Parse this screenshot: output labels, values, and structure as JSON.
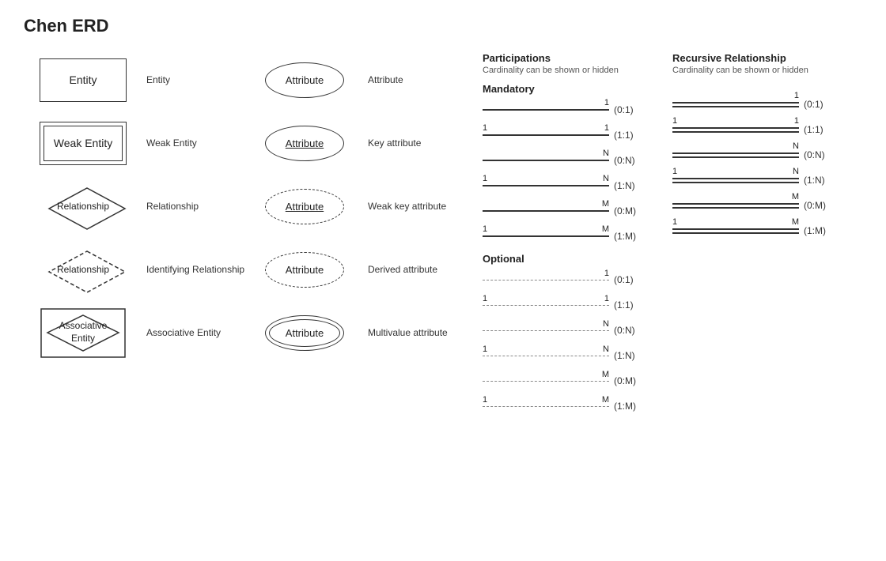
{
  "title": "Chen ERD",
  "symbols": [
    {
      "type": "entity",
      "shape": "entity-rect",
      "text": "Entity",
      "label": "Entity"
    },
    {
      "type": "weak-entity",
      "shape": "weak-entity-rect",
      "text": "Weak Entity",
      "label": "Weak Entity"
    },
    {
      "type": "relationship",
      "shape": "diamond",
      "text": "Relationship",
      "label": "Relationship"
    },
    {
      "type": "identifying-relationship",
      "shape": "diamond-dashed",
      "text": "Relationship",
      "label": "Identifying Relationship"
    },
    {
      "type": "associative-entity",
      "shape": "assoc-entity",
      "text": "Associative\nEntity",
      "label": "Associative Entity"
    }
  ],
  "attributes": [
    {
      "type": "normal",
      "text": "Attribute",
      "label": "Attribute"
    },
    {
      "type": "key",
      "text": "Attribute",
      "label": "Key attribute"
    },
    {
      "type": "weak-key",
      "text": "Attribute",
      "label": "Weak key attribute"
    },
    {
      "type": "derived",
      "text": "Attribute",
      "label": "Derived attribute"
    },
    {
      "type": "multivalue",
      "text": "Attribute",
      "label": "Multivalue attribute"
    }
  ],
  "participations": {
    "title": "Participations",
    "subtitle": "Cardinality can be shown or hidden",
    "mandatory_label": "Mandatory",
    "optional_label": "Optional",
    "mandatory_rows": [
      {
        "left": "",
        "right": "1",
        "cardinality": "(0:1)",
        "line_type": "single"
      },
      {
        "left": "1",
        "right": "1",
        "cardinality": "(1:1)",
        "line_type": "single"
      },
      {
        "left": "",
        "right": "N",
        "cardinality": "(0:N)",
        "line_type": "single"
      },
      {
        "left": "1",
        "right": "N",
        "cardinality": "(1:N)",
        "line_type": "single"
      },
      {
        "left": "",
        "right": "M",
        "cardinality": "(0:M)",
        "line_type": "single"
      },
      {
        "left": "1",
        "right": "M",
        "cardinality": "(1:M)",
        "line_type": "single"
      }
    ],
    "optional_rows": [
      {
        "left": "",
        "right": "1",
        "cardinality": "(0:1)",
        "line_type": "dashed"
      },
      {
        "left": "1",
        "right": "1",
        "cardinality": "(1:1)",
        "line_type": "dashed"
      },
      {
        "left": "",
        "right": "N",
        "cardinality": "(0:N)",
        "line_type": "dashed"
      },
      {
        "left": "1",
        "right": "N",
        "cardinality": "(1:N)",
        "line_type": "dashed"
      },
      {
        "left": "",
        "right": "M",
        "cardinality": "(0:M)",
        "line_type": "dashed"
      },
      {
        "left": "1",
        "right": "M",
        "cardinality": "(1:M)",
        "line_type": "dashed"
      }
    ]
  },
  "recursive": {
    "title": "Recursive Relationship",
    "subtitle": "Cardinality can be shown or hidden",
    "rows": [
      {
        "left": "",
        "right": "1",
        "cardinality": "(0:1)"
      },
      {
        "left": "1",
        "right": "1",
        "cardinality": "(1:1)"
      },
      {
        "left": "",
        "right": "N",
        "cardinality": "(0:N)"
      },
      {
        "left": "1",
        "right": "N",
        "cardinality": "(1:N)"
      },
      {
        "left": "",
        "right": "M",
        "cardinality": "(0:M)"
      },
      {
        "left": "1",
        "right": "M",
        "cardinality": "(1:M)"
      }
    ]
  }
}
